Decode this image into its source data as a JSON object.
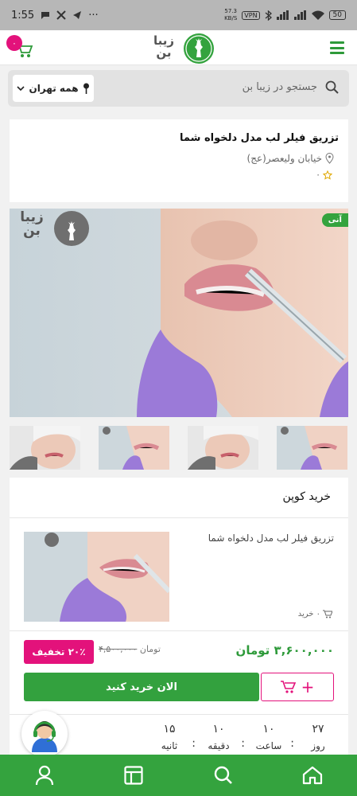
{
  "status_bar": {
    "time": "1:55",
    "data_rate": "57.3",
    "data_unit": "KB/S",
    "vpn": "VPN",
    "battery": "50",
    "dots": "···"
  },
  "header": {
    "cart_count": "۰",
    "logo_line1": "زیبا",
    "logo_line2": "بن"
  },
  "search": {
    "placeholder": "جستجو در زیبا بن",
    "city": "همه تهران"
  },
  "product": {
    "title": "تزریق فیلر لب مدل دلخواه شما",
    "address": "خیابان ولیعصر(عج)",
    "rating": "۰",
    "badge_new": "آنی",
    "image_logo_line1": "زیبا",
    "image_logo_line2": "بن"
  },
  "coupon": {
    "heading": "خرید کوپن",
    "item_name": "تزریق فیلر لب مدل دلخواه شما",
    "buy_count": "۰ خرید",
    "price": "۳,۶۰۰,۰۰۰ تومان",
    "old_price_value": "۴,۵۰۰,۰۰۰",
    "old_price_unit": "تومان",
    "discount": "۲۰٪ تخفیف",
    "buy_now": "الان خرید کنید",
    "add_cart_plus": "+"
  },
  "timer": {
    "days_value": "۲۷",
    "days_label": "روز",
    "hours_value": "۱۰",
    "hours_label": "ساعت",
    "minutes_value": "۱۰",
    "minutes_label": "دقیقه",
    "seconds_value": "۱۵",
    "seconds_label": "ثانیه"
  },
  "colors": {
    "brand_green": "#34a33e",
    "accent_pink": "#e3127b",
    "glove_purple": "#9b7ad8",
    "lip_pink": "#d98a92"
  },
  "icons": {
    "bottom_nav": [
      "user-icon",
      "layout-icon",
      "search-icon",
      "home-icon"
    ],
    "header": [
      "cart-icon",
      "logo-deer-icon",
      "menu-icon"
    ]
  }
}
